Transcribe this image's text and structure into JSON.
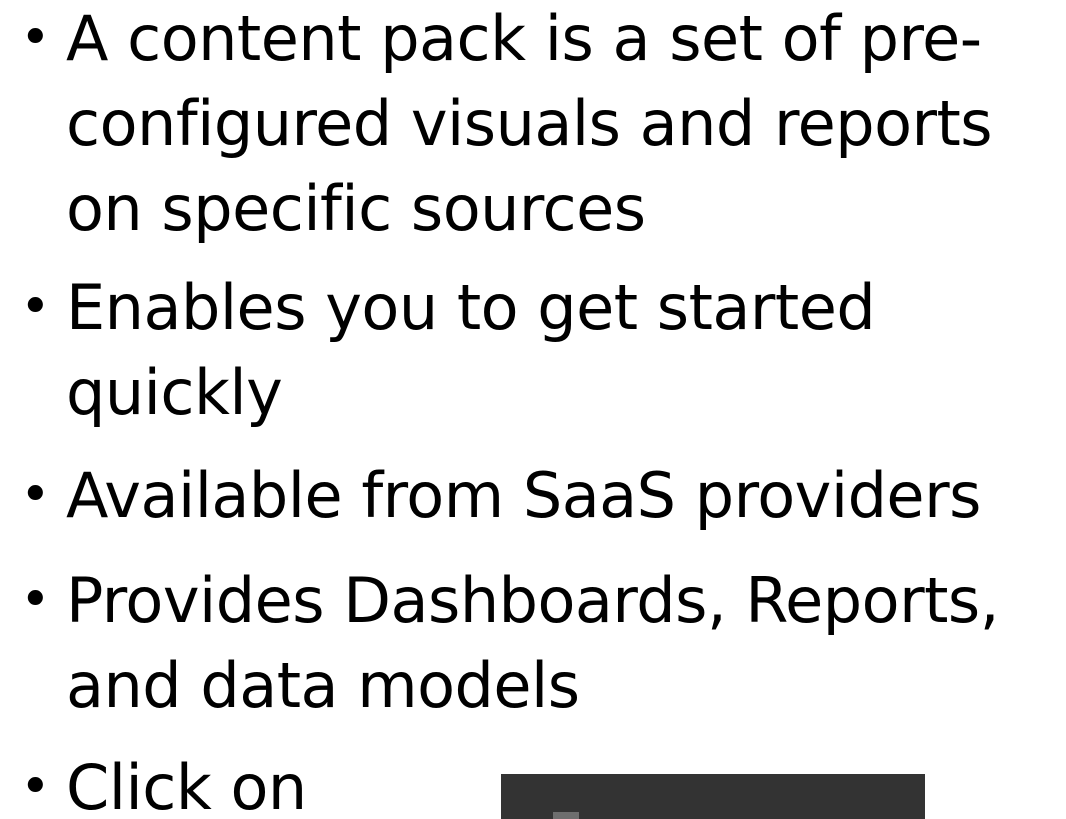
{
  "bullets": [
    "A content pack is a set of pre-configured visuals and reports on specific sources",
    "Enables you to get started quickly",
    "Available from SaaS providers",
    "Provides Dashboards, Reports, and data models",
    "Click on"
  ],
  "bullet_symbol": "•",
  "colors": {
    "text": "#000000",
    "background": "#ffffff",
    "panel": "#333333"
  }
}
